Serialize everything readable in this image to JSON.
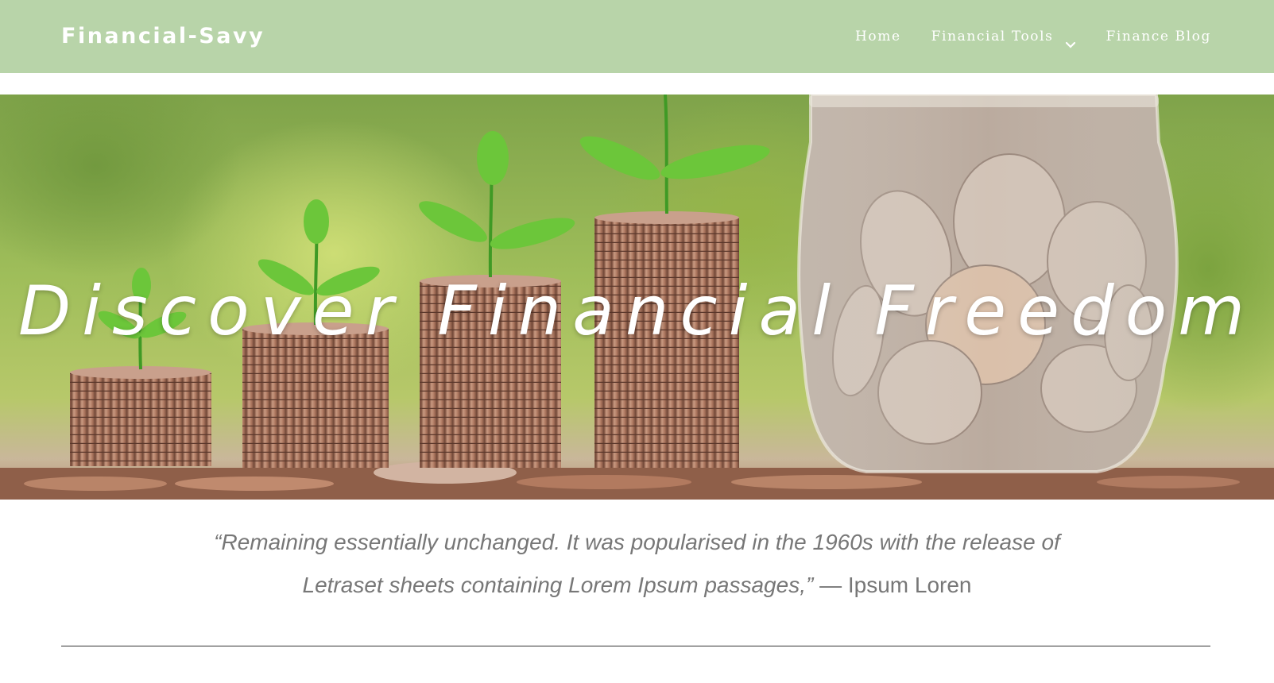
{
  "header": {
    "brand": "Financial-Savy",
    "background_color": "#b8d4a9",
    "nav": [
      {
        "label": "Home"
      },
      {
        "label": "Financial Tools",
        "icon": "chevron-down-icon"
      },
      {
        "label": "Finance Blog"
      }
    ]
  },
  "hero": {
    "title": "Discover Financial Freedom",
    "image_description": "coin stacks with growing plants and a glass jar of coins"
  },
  "quote": {
    "text": "“Remaining essentially unchanged. It was popularised in the 1960s with the release of Letraset sheets containing Lorem Ipsum passages,”",
    "author": "— Ipsum Loren"
  }
}
